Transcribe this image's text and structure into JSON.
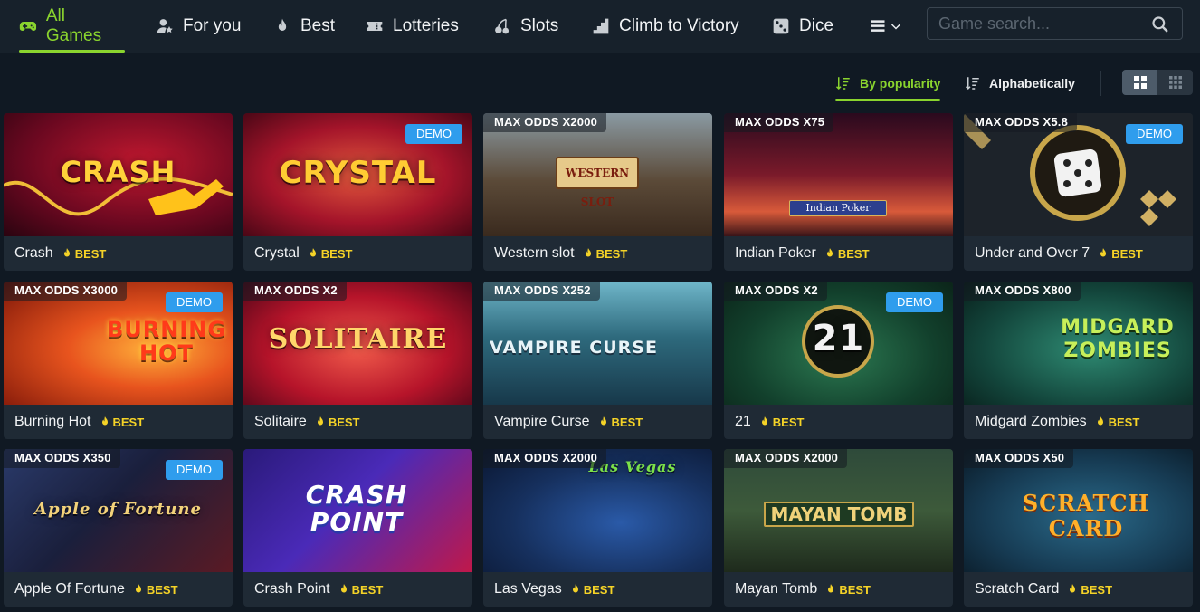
{
  "nav": {
    "items": [
      {
        "label": "All Games",
        "icon": "gamepad-icon",
        "active": true
      },
      {
        "label": "For you",
        "icon": "user-star-icon"
      },
      {
        "label": "Best",
        "icon": "flame-icon"
      },
      {
        "label": "Lotteries",
        "icon": "ticket-icon"
      },
      {
        "label": "Slots",
        "icon": "cherries-icon"
      },
      {
        "label": "Climb to Victory",
        "icon": "stairs-icon"
      },
      {
        "label": "Dice",
        "icon": "dice-icon"
      },
      {
        "label": "",
        "icon": "list-menu-icon"
      }
    ],
    "search_placeholder": "Game search..."
  },
  "sort": {
    "popularity": "By popularity",
    "alphabetical": "Alphabetically",
    "active": "popularity",
    "view": "large-grid"
  },
  "labels": {
    "best": "BEST",
    "demo": "DEMO"
  },
  "colors": {
    "accent": "#8ad42e",
    "best": "#f5d327",
    "demo": "#2f9ded",
    "card": "#1f2a35",
    "page": "#101923",
    "nav": "#17212b"
  },
  "games": [
    {
      "name": "Crash",
      "art_title": "CRASH",
      "odds": "",
      "demo": false,
      "best": true
    },
    {
      "name": "Crystal",
      "art_title": "CRYSTAL",
      "odds": "",
      "demo": true,
      "best": true
    },
    {
      "name": "Western slot",
      "art_title": "WESTERN SLOT",
      "odds": "MAX ODDS X2000",
      "demo": false,
      "best": true
    },
    {
      "name": "Indian Poker",
      "art_title": "Indian Poker",
      "odds": "MAX ODDS X75",
      "demo": false,
      "best": true
    },
    {
      "name": "Under and Over 7",
      "art_title": "",
      "odds": "MAX ODDS X5.8",
      "demo": true,
      "best": true
    },
    {
      "name": "Burning Hot",
      "art_title": "BURNING HOT",
      "odds": "MAX ODDS X3000",
      "demo": true,
      "best": true
    },
    {
      "name": "Solitaire",
      "art_title": "SOLITAIRE",
      "odds": "MAX ODDS X2",
      "demo": false,
      "best": true
    },
    {
      "name": "Vampire Curse",
      "art_title": "VAMPIRE CURSE",
      "odds": "MAX ODDS X252",
      "demo": false,
      "best": true
    },
    {
      "name": "21",
      "art_title": "21",
      "odds": "MAX ODDS X2",
      "demo": true,
      "best": true
    },
    {
      "name": "Midgard Zombies",
      "art_title": "MIDGARD ZOMBIES",
      "odds": "MAX ODDS X800",
      "demo": false,
      "best": true
    },
    {
      "name": "Apple Of Fortune",
      "art_title": "Apple of Fortune",
      "odds": "MAX ODDS X350",
      "demo": true,
      "best": true
    },
    {
      "name": "Crash Point",
      "art_title": "CRASH POINT",
      "odds": "",
      "demo": false,
      "best": true
    },
    {
      "name": "Las Vegas",
      "art_title": "Las Vegas",
      "odds": "MAX ODDS X2000",
      "demo": false,
      "best": true
    },
    {
      "name": "Mayan Tomb",
      "art_title": "MAYAN TOMB",
      "odds": "MAX ODDS X2000",
      "demo": false,
      "best": true
    },
    {
      "name": "Scratch Card",
      "art_title": "SCRATCH CARD",
      "odds": "MAX ODDS X50",
      "demo": false,
      "best": true
    }
  ]
}
